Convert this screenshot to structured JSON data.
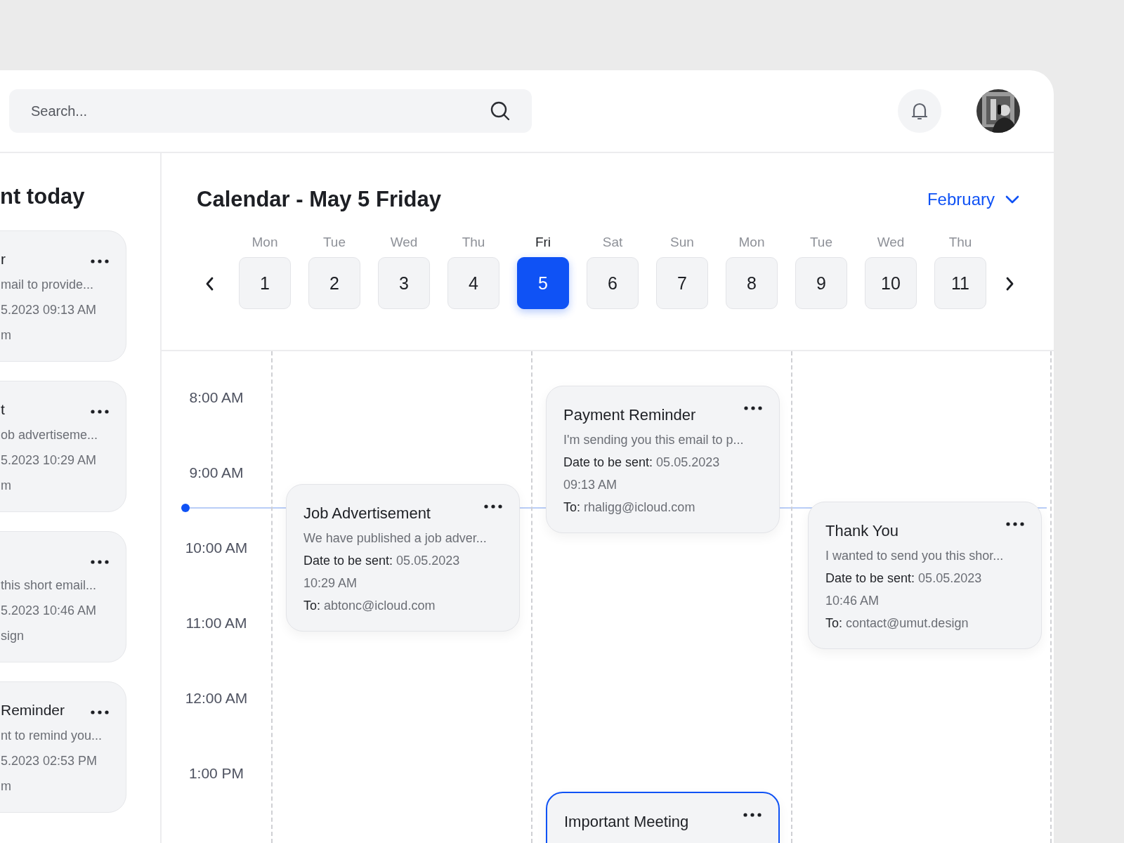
{
  "search": {
    "placeholder": "Search..."
  },
  "sidebar": {
    "heading": "nt today",
    "cards": [
      {
        "title": "r",
        "preview": "mail to provide...",
        "date": "5.2023 09:13 AM",
        "to": "m"
      },
      {
        "title": "t",
        "preview": "ob advertiseme...",
        "date": "5.2023 10:29 AM",
        "to": "m"
      },
      {
        "preview": "this short email...",
        "date": "5.2023 10:46 AM",
        "to": "sign"
      },
      {
        "title": "Reminder",
        "preview": "nt to remind you...",
        "date": "5.2023 02:53 PM",
        "to": "m"
      }
    ]
  },
  "calendar": {
    "title": "Calendar - May 5 Friday",
    "month": "February",
    "days": [
      {
        "name": "Mon",
        "number": "1",
        "selected": false
      },
      {
        "name": "Tue",
        "number": "2",
        "selected": false
      },
      {
        "name": "Wed",
        "number": "3",
        "selected": false
      },
      {
        "name": "Thu",
        "number": "4",
        "selected": false
      },
      {
        "name": "Fri",
        "number": "5",
        "selected": true
      },
      {
        "name": "Sat",
        "number": "6",
        "selected": false
      },
      {
        "name": "Sun",
        "number": "7",
        "selected": false
      },
      {
        "name": "Mon",
        "number": "8",
        "selected": false
      },
      {
        "name": "Tue",
        "number": "9",
        "selected": false
      },
      {
        "name": "Wed",
        "number": "10",
        "selected": false
      },
      {
        "name": "Thu",
        "number": "11",
        "selected": false
      }
    ]
  },
  "times": [
    "8:00 AM",
    "9:00 AM",
    "10:00 AM",
    "11:00 AM",
    "12:00 AM",
    "1:00 PM"
  ],
  "columns": [
    {
      "events": [
        {
          "title": "Job Advertisement",
          "preview": "We have published a job adver...",
          "date_label": "Date to be sent:",
          "date": "05.05.2023 10:29 AM",
          "to_label": "To:",
          "to": "abtonc@icloud.com",
          "highlighted": false
        }
      ]
    },
    {
      "events": [
        {
          "title": "Payment Reminder",
          "preview": "I'm sending you this email to p...",
          "date_label": "Date to be sent:",
          "date": "05.05.2023 09:13 AM",
          "to_label": "To:",
          "to": "rhaligg@icloud.com",
          "highlighted": false
        },
        {
          "title": "Important Meeting",
          "highlighted": true
        }
      ]
    },
    {
      "events": [
        {
          "title": "Thank You",
          "preview": "I wanted to send you this shor...",
          "date_label": "Date to be sent:",
          "date": "05.05.2023 10:46 AM",
          "to_label": "To:",
          "to": "contact@umut.design",
          "highlighted": false
        }
      ]
    }
  ]
}
